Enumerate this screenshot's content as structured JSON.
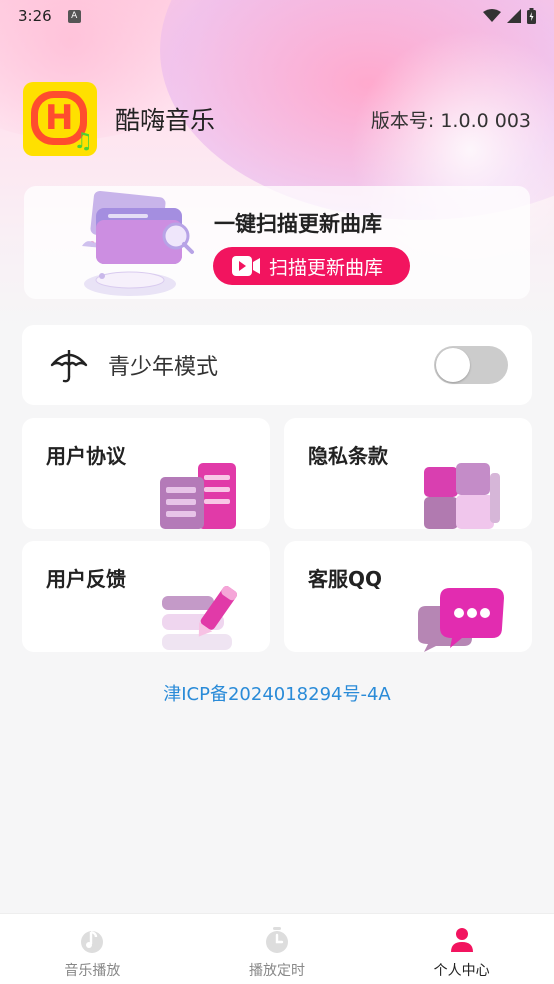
{
  "status_bar": {
    "time": "3:26",
    "notification_letter": "A"
  },
  "header": {
    "app_name": "酷嗨音乐",
    "version_label": "版本号: 1.0.0 003"
  },
  "scan_card": {
    "title": "一键扫描更新曲库",
    "button_label": "扫描更新曲库"
  },
  "youth_mode": {
    "label": "青少年模式",
    "enabled": false
  },
  "feature_cards": [
    {
      "label": "用户协议"
    },
    {
      "label": "隐私条款"
    },
    {
      "label": "用户反馈"
    },
    {
      "label": "客服QQ"
    }
  ],
  "icp": "津ICP备2024018294号-4A",
  "bottom_nav": [
    {
      "label": "音乐播放",
      "icon": "music-note-icon",
      "active": false
    },
    {
      "label": "播放定时",
      "icon": "timer-icon",
      "active": false
    },
    {
      "label": "个人中心",
      "icon": "person-icon",
      "active": true
    }
  ],
  "colors": {
    "accent": "#f2145f",
    "link": "#2a8bd8",
    "logo_yellow": "#ffe000",
    "logo_red": "#ff4d2e"
  }
}
